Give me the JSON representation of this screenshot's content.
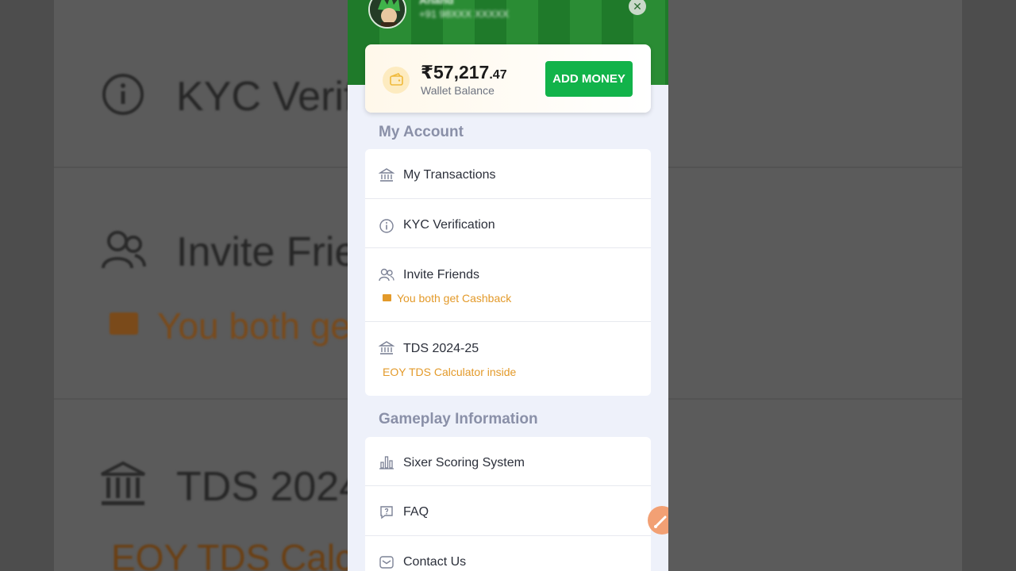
{
  "background_copy": {
    "kyc": "KYC Verif",
    "invite": "Invite Frie",
    "cashback": "You both ge",
    "tds": "TDS 2024",
    "tds_sub": "EOY TDS Calcul"
  },
  "header": {
    "user_name": "Anand",
    "user_phone": "+91 98XXX XXXXX",
    "close_icon": "close-icon"
  },
  "wallet": {
    "amount_main": "₹57,217",
    "amount_decimal": ".47",
    "label": "Wallet Balance",
    "add_money_label": "ADD MONEY",
    "icon": "wallet-icon"
  },
  "my_account": {
    "title": "My Account",
    "items": [
      {
        "label": "My Transactions",
        "icon": "bank-icon"
      },
      {
        "label": "KYC Verification",
        "icon": "info-icon"
      },
      {
        "label": "Invite Friends",
        "icon": "users-icon",
        "sub": "You both get Cashback"
      },
      {
        "label": "TDS 2024-25",
        "icon": "bank-icon",
        "sub": "EOY TDS Calculator inside"
      }
    ]
  },
  "gameplay": {
    "title": "Gameplay Information",
    "items": [
      {
        "label": "Sixer Scoring System",
        "icon": "bar-chart-icon"
      },
      {
        "label": "FAQ",
        "icon": "question-bubble-icon"
      },
      {
        "label": "Contact Us",
        "icon": "mail-icon"
      }
    ]
  },
  "colors": {
    "accent_green": "#12b34a",
    "section_title": "#8a90a8",
    "sub_orange": "#e39a2a"
  }
}
